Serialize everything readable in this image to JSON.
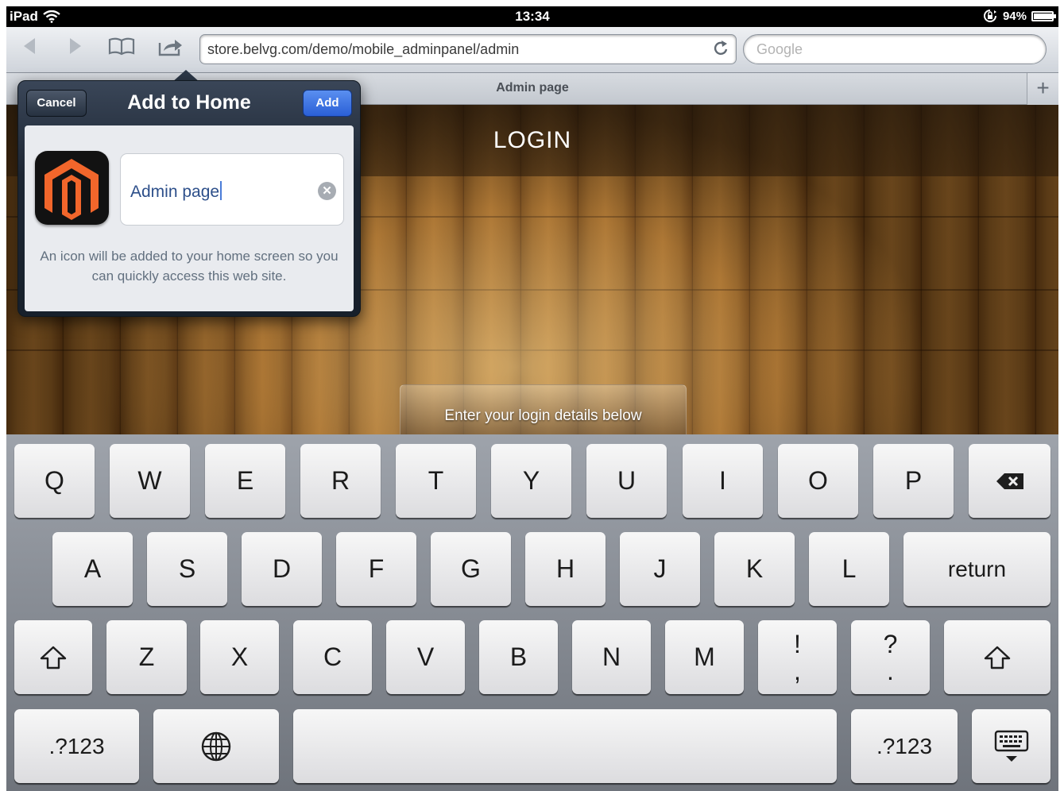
{
  "status_bar": {
    "device": "iPad",
    "time": "13:34",
    "battery_percent": "94%",
    "battery_level": 0.94
  },
  "toolbar": {
    "back_icon": "back-arrow-icon",
    "forward_icon": "forward-arrow-icon",
    "bookmarks_icon": "open-book-icon",
    "share_icon": "share-icon",
    "url": "store.belvg.com/demo/mobile_adminpanel/admin",
    "reload_icon": "reload-icon",
    "search_placeholder": "Google"
  },
  "tab": {
    "title": "Admin page",
    "new_tab_icon": "plus-icon"
  },
  "page": {
    "heading": "LOGIN",
    "login_prompt": "Enter your login details below"
  },
  "popover": {
    "title": "Add to Home",
    "cancel_label": "Cancel",
    "add_label": "Add",
    "name_value": "Admin page",
    "note": "An icon will be added to your home screen so you can quickly access this web site.",
    "app_icon": "magento-logo-icon",
    "clear_icon": "clear-icon"
  },
  "keyboard": {
    "row1": [
      "Q",
      "W",
      "E",
      "R",
      "T",
      "Y",
      "U",
      "I",
      "O",
      "P"
    ],
    "row2": [
      "A",
      "S",
      "D",
      "F",
      "G",
      "H",
      "J",
      "K",
      "L"
    ],
    "row3": [
      "Z",
      "X",
      "C",
      "V",
      "B",
      "N",
      "M"
    ],
    "return_label": "return",
    "numbers_label": ".?123",
    "punct1_top": "!",
    "punct1_bottom": ",",
    "punct2_top": "?",
    "punct2_bottom": ".",
    "backspace_icon": "backspace-icon",
    "shift_icon": "shift-icon",
    "globe_icon": "globe-icon",
    "hide_keyboard_icon": "hide-keyboard-icon"
  }
}
